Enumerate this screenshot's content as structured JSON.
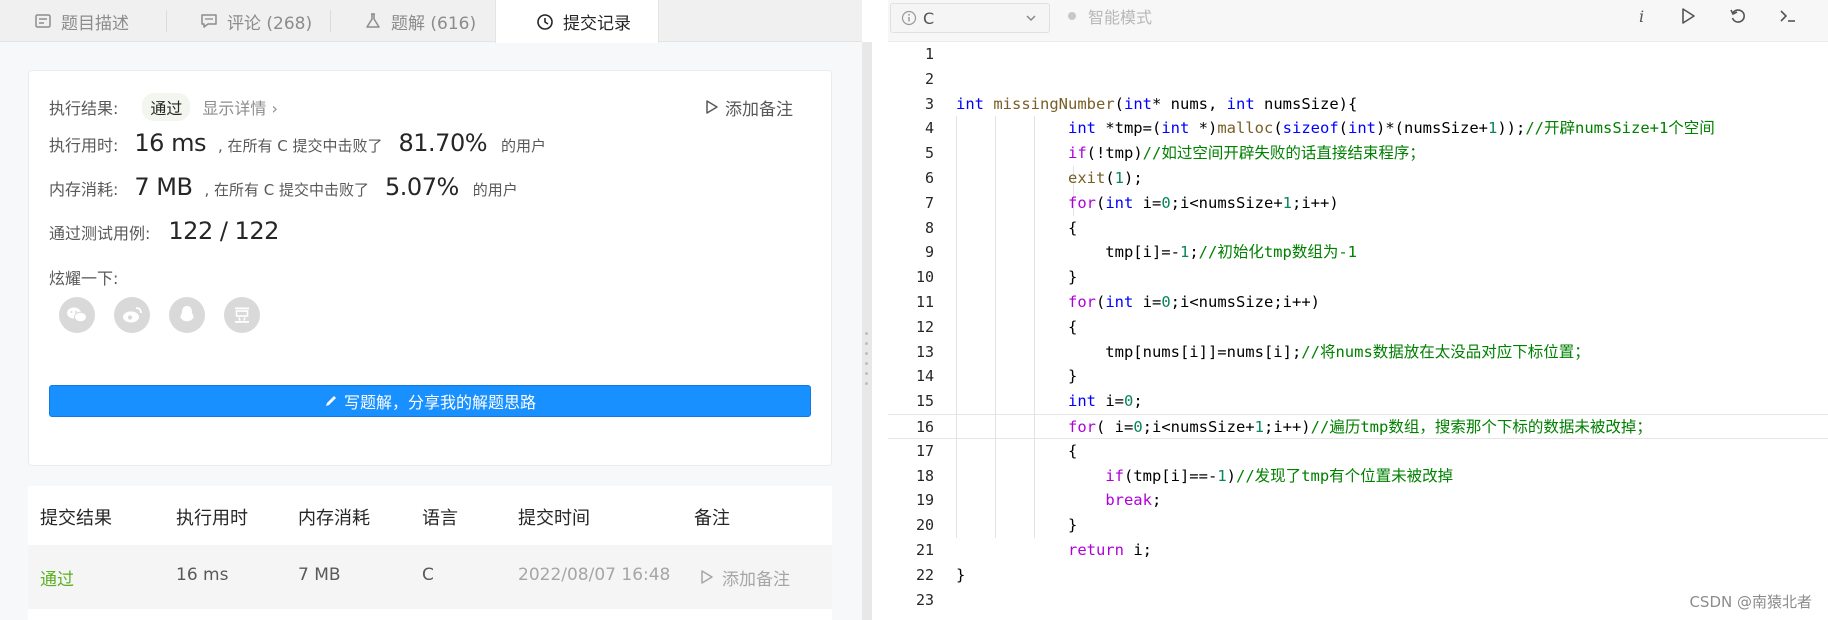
{
  "tabs": [
    {
      "label": "题目描述",
      "icon": "description-icon"
    },
    {
      "label": "评论 (268)",
      "icon": "comment-icon"
    },
    {
      "label": "题解 (616)",
      "icon": "flask-icon"
    },
    {
      "label": "提交记录",
      "icon": "clock-icon"
    }
  ],
  "result": {
    "label": "执行结果:",
    "status": "通过",
    "details_link": "显示详情 ›",
    "add_note": "添加备注",
    "runtime_label": "执行用时:",
    "runtime_value": "16 ms",
    "runtime_mid": ", 在所有 C 提交中击败了",
    "runtime_percent": "81.70%",
    "runtime_tail": "的用户",
    "memory_label": "内存消耗:",
    "memory_value": "7 MB",
    "memory_mid": ", 在所有 C 提交中击败了",
    "memory_percent": "5.07%",
    "memory_tail": "的用户",
    "tests_label": "通过测试用例:",
    "tests_value": "122 / 122",
    "share_label": "炫耀一下:",
    "share_icons": [
      "wechat-icon",
      "weibo-icon",
      "qq-icon",
      "douban-icon"
    ],
    "solution_button": "写题解，分享我的解题思路"
  },
  "table": {
    "headers": [
      "提交结果",
      "执行用时",
      "内存消耗",
      "语言",
      "提交时间",
      "备注"
    ],
    "rows": [
      {
        "status": "通过",
        "runtime": "16 ms",
        "memory": "7 MB",
        "lang": "C",
        "time": "2022/08/07 16:48",
        "note": "添加备注"
      }
    ]
  },
  "editor": {
    "language": "C",
    "smart_mode": "智能模式",
    "toolbar_icons": [
      "info-icon",
      "run-icon",
      "reset-icon",
      "console-icon"
    ],
    "line_numbers": [
      "1",
      "2",
      "3",
      "4",
      "5",
      "6",
      "7",
      "8",
      "9",
      "10",
      "11",
      "12",
      "13",
      "14",
      "15",
      "16",
      "17",
      "18",
      "19",
      "20",
      "21",
      "22",
      "23"
    ],
    "current_line": 16
  },
  "watermark": "CSDN @南猿北者"
}
